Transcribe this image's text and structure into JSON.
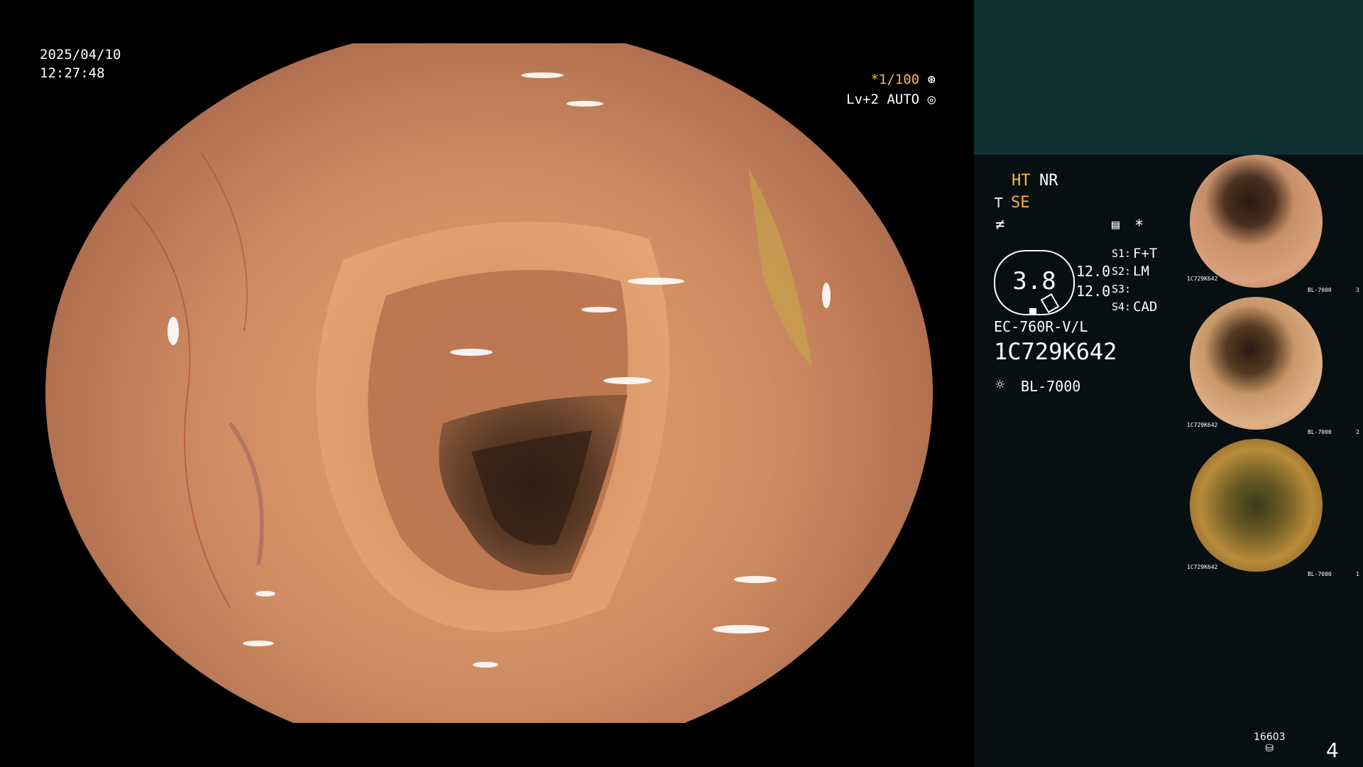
{
  "main_view": {
    "date": "2025/04/10",
    "time": "12:27:48",
    "shutter": "*1/100",
    "shutter_icon": "aperture-icon",
    "level": "Lv+2 AUTO",
    "level_icon": "iris-icon"
  },
  "panel": {
    "ht": "HT",
    "nr": "NR",
    "se": "SE",
    "zoom": "3.8",
    "zoom_a": "12.0",
    "zoom_b": "12.0",
    "s1_label": "S1:",
    "s1_value": "F+T",
    "s2_label": "S2:",
    "s2_value": "LM",
    "s3_label": "S3:",
    "s3_value": "",
    "s4_label": "S4:",
    "s4_value": "CAD",
    "scope_model": "EC-760R-V/L",
    "serial": "1C729K642",
    "light_source": "BL-7000",
    "star": "*"
  },
  "thumbnails": [
    {
      "serial": "1C729K642",
      "light": "BL-7000",
      "index": "3"
    },
    {
      "serial": "1C729K642",
      "light": "BL-7000",
      "index": "2"
    },
    {
      "serial": "1C729K642",
      "light": "BL-7000",
      "index": "1"
    }
  ],
  "footer": {
    "count": "16603",
    "page": "4"
  },
  "colors": {
    "accent": "#ffb43c",
    "panel_top": "#0f2f33",
    "panel_bottom": "#070f10"
  }
}
